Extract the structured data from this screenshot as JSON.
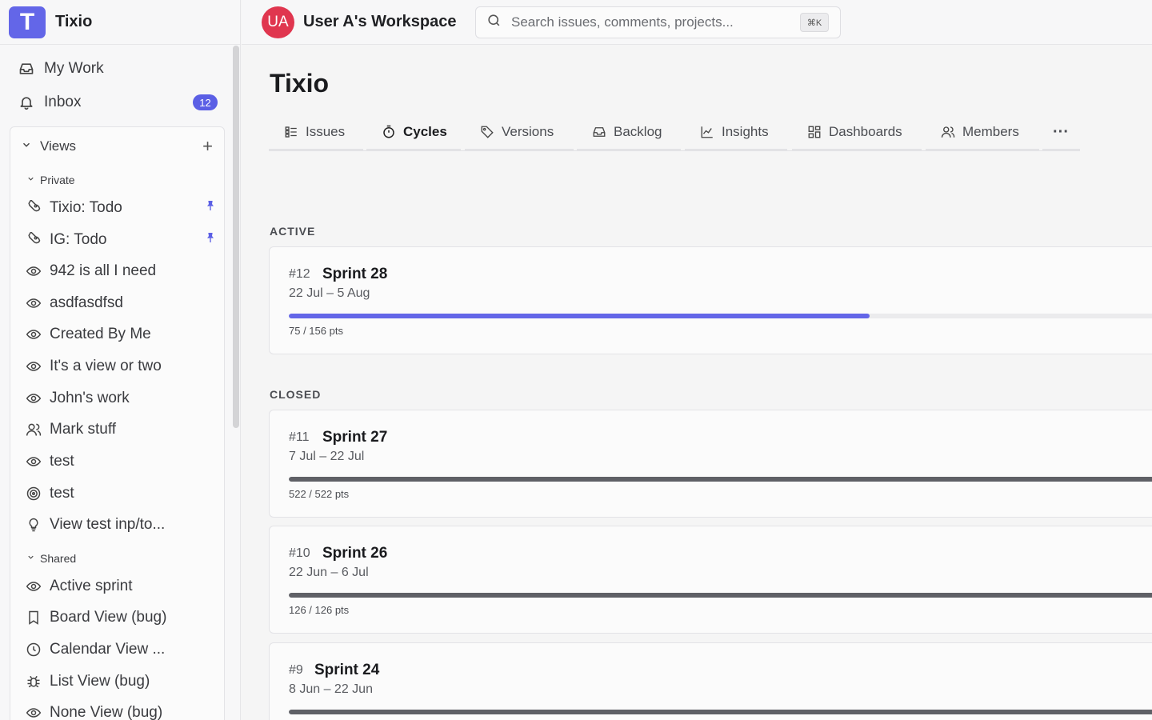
{
  "brand": {
    "logo_letter": "T",
    "name": "Tixio"
  },
  "sidebar": {
    "top_items": [
      {
        "label": "My Work",
        "icon": "inbox-tray-icon"
      },
      {
        "label": "Inbox",
        "icon": "bell-icon",
        "badge": "12"
      }
    ],
    "views": {
      "title": "Views",
      "add_label": "+",
      "private_label": "Private",
      "shared_label": "Shared",
      "private_items": [
        {
          "label": "Tixio: Todo",
          "icon": "rocket-icon",
          "pinned": true
        },
        {
          "label": "IG: Todo",
          "icon": "rocket-icon",
          "pinned": true
        },
        {
          "label": "942 is all I need",
          "icon": "eye-icon"
        },
        {
          "label": "asdfasdfsd",
          "icon": "eye-icon"
        },
        {
          "label": "Created By Me",
          "icon": "eye-icon"
        },
        {
          "label": "It's a view or two",
          "icon": "eye-icon"
        },
        {
          "label": "John's work",
          "icon": "eye-icon"
        },
        {
          "label": "Mark stuff",
          "icon": "users-icon"
        },
        {
          "label": "test",
          "icon": "eye-icon"
        },
        {
          "label": "test",
          "icon": "target-icon"
        },
        {
          "label": "View test inp/to...",
          "icon": "lightbulb-icon"
        }
      ],
      "shared_items": [
        {
          "label": "Active sprint",
          "icon": "eye-icon"
        },
        {
          "label": "Board View (bug)",
          "icon": "bookmark-icon"
        },
        {
          "label": "Calendar View ...",
          "icon": "clock-icon"
        },
        {
          "label": "List View (bug)",
          "icon": "bug-icon"
        },
        {
          "label": "None View (bug)",
          "icon": "eye-icon"
        }
      ]
    }
  },
  "header": {
    "avatar_initials": "UA",
    "workspace_name": "User A's Workspace",
    "search_placeholder": "Search issues, comments, projects...",
    "search_shortcut": "⌘K"
  },
  "main": {
    "title": "Tixio",
    "tabs": [
      {
        "label": "Issues",
        "icon": "list-icon"
      },
      {
        "label": "Cycles",
        "icon": "timer-icon",
        "active": true
      },
      {
        "label": "Versions",
        "icon": "tag-icon"
      },
      {
        "label": "Backlog",
        "icon": "inbox-tray-icon"
      },
      {
        "label": "Insights",
        "icon": "line-chart-icon"
      },
      {
        "label": "Dashboards",
        "icon": "dashboard-grid-icon"
      },
      {
        "label": "Members",
        "icon": "users-icon"
      }
    ],
    "more_label": "···",
    "active_label": "ACTIVE",
    "closed_label": "CLOSED",
    "active_cycles": [
      {
        "number": "#12",
        "name": "Sprint 28",
        "dates": "22 Jul – 5 Aug",
        "points": "75 / 156 pts",
        "progress": 0.66
      }
    ],
    "closed_cycles": [
      {
        "number": "#11",
        "name": "Sprint 27",
        "dates": "7 Jul – 22 Jul",
        "points": "522 / 522 pts",
        "progress": 1.0
      },
      {
        "number": "#10",
        "name": "Sprint 26",
        "dates": "22 Jun – 6 Jul",
        "points": "126 / 126 pts",
        "progress": 1.0
      },
      {
        "number": "#9",
        "name": "Sprint 24",
        "dates": "8 Jun – 22 Jun",
        "points": "",
        "progress": 1.0
      }
    ]
  },
  "colors": {
    "accent": "#5b5fe5",
    "active_progress": "#6366e8",
    "closed_progress": "#5f6066",
    "avatar": "#e0364f"
  }
}
